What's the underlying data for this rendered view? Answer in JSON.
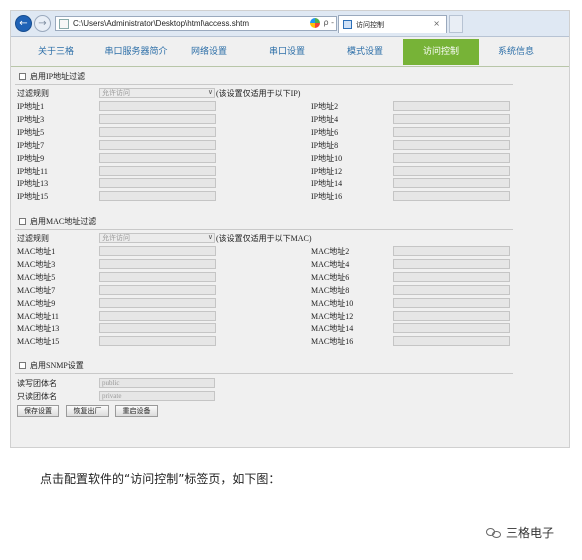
{
  "browser": {
    "url": "C:\\Users\\Administrator\\Desktop\\html\\access.shtm",
    "tab_title": "访问控制",
    "tab_close": "×",
    "search_glyph": "ρ -",
    "back_glyph": "←",
    "forward_glyph": "→"
  },
  "menu": [
    {
      "label": "关于三格",
      "active": false
    },
    {
      "label": "串口服务器简介",
      "active": false
    },
    {
      "label": "网络设置",
      "active": false
    },
    {
      "label": "串口设置",
      "active": false
    },
    {
      "label": "模式设置",
      "active": false
    },
    {
      "label": "访问控制",
      "active": true
    },
    {
      "label": "系统信息",
      "active": false
    }
  ],
  "ip_section": {
    "title": "启用IP地址过滤",
    "rule_label": "过滤规则",
    "rule_value": "允许访问",
    "rule_note": "(该设置仅适用于以下IP)",
    "addresses": [
      "IP地址1",
      "IP地址2",
      "IP地址3",
      "IP地址4",
      "IP地址5",
      "IP地址6",
      "IP地址7",
      "IP地址8",
      "IP地址9",
      "IP地址10",
      "IP地址11",
      "IP地址12",
      "IP地址13",
      "IP地址14",
      "IP地址15",
      "IP地址16"
    ]
  },
  "mac_section": {
    "title": "启用MAC地址过滤",
    "rule_label": "过滤规则",
    "rule_value": "允许访问",
    "rule_note": "(该设置仅适用于以下MAC)",
    "addresses": [
      "MAC地址1",
      "MAC地址2",
      "MAC地址3",
      "MAC地址4",
      "MAC地址5",
      "MAC地址6",
      "MAC地址7",
      "MAC地址8",
      "MAC地址9",
      "MAC地址10",
      "MAC地址11",
      "MAC地址12",
      "MAC地址13",
      "MAC地址14",
      "MAC地址15",
      "MAC地址16"
    ]
  },
  "snmp_section": {
    "title": "启用SNMP设置",
    "rw_label": "读写团体名",
    "rw_value": "public",
    "ro_label": "只读团体名",
    "ro_value": "private"
  },
  "buttons": {
    "save": "保存设置",
    "restore": "恢复出厂",
    "reboot": "重启设备"
  },
  "caption": "点击配置软件的“访问控制”标签页，如下图：",
  "watermark": "三格电子"
}
